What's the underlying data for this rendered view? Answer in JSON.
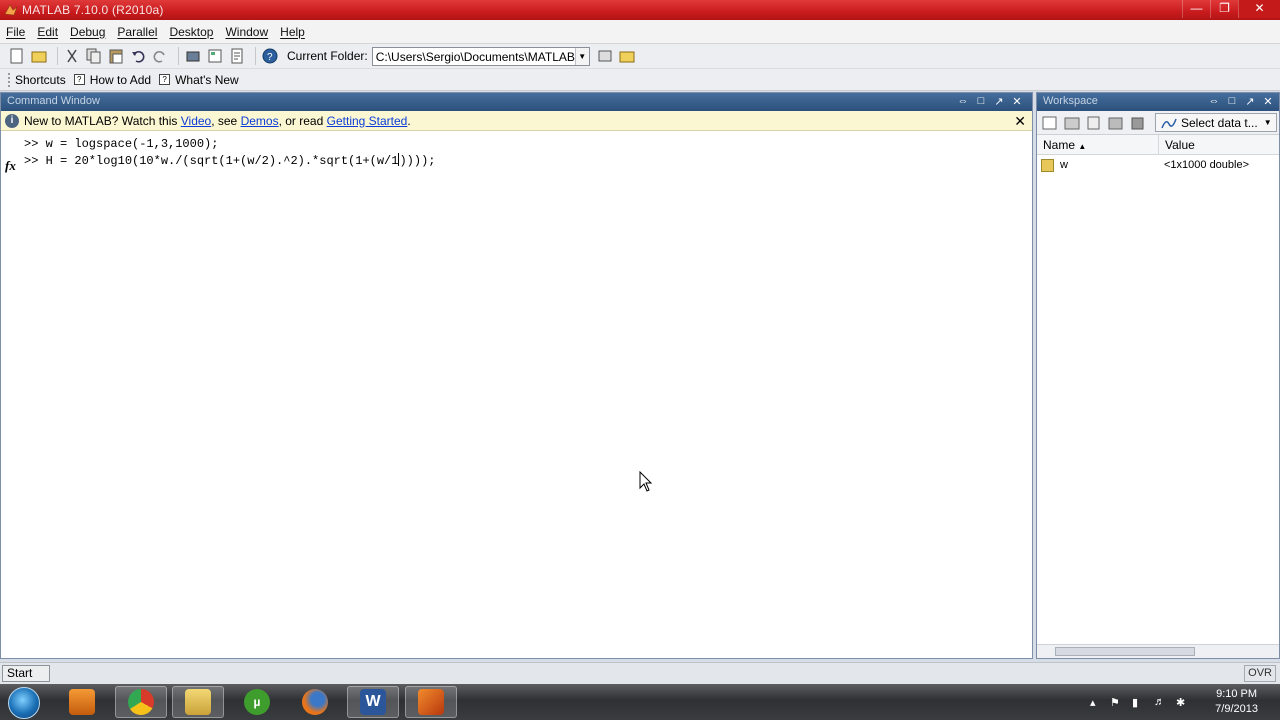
{
  "window": {
    "title": "MATLAB  7.10.0 (R2010a)",
    "controls": [
      "minimize",
      "maximize",
      "close"
    ]
  },
  "menu": [
    "File",
    "Edit",
    "Debug",
    "Parallel",
    "Desktop",
    "Window",
    "Help"
  ],
  "toolbar": {
    "current_folder_label": "Current Folder:",
    "current_folder_value": "C:\\Users\\Sergio\\Documents\\MATLAB"
  },
  "shortcuts": {
    "label": "Shortcuts",
    "items": [
      "How to Add",
      "What's New"
    ]
  },
  "command_window": {
    "title": "Command Window",
    "info": {
      "prefix": "New to MATLAB? Watch this ",
      "video": "Video",
      "mid1": ", see ",
      "demos": "Demos",
      "mid2": ", or read ",
      "getting_started": "Getting Started",
      "end": "."
    },
    "lines": [
      ">> w = logspace(-1,3,1000);",
      ">> H = 20*log10(10*w./(sqrt(1+(w/2).^2).*sqrt(1+(w/1"
    ],
    "line2_tail": "))));",
    "fx_label": "fx"
  },
  "workspace": {
    "title": "Workspace",
    "select_data_label": "Select data t...",
    "columns": [
      "Name",
      "Value"
    ],
    "rows": [
      {
        "name": "w",
        "value": "<1x1000 double>"
      }
    ]
  },
  "statusbar": {
    "start_label": "Start",
    "ovr_label": "OVR"
  },
  "taskbar": {
    "time": "9:10 PM",
    "date": "7/9/2013"
  },
  "colors": {
    "title_bar": "#c91b1e",
    "panel_title": "#2c507c",
    "info_bar": "#fbf7d2",
    "link": "#0b3cd8"
  }
}
